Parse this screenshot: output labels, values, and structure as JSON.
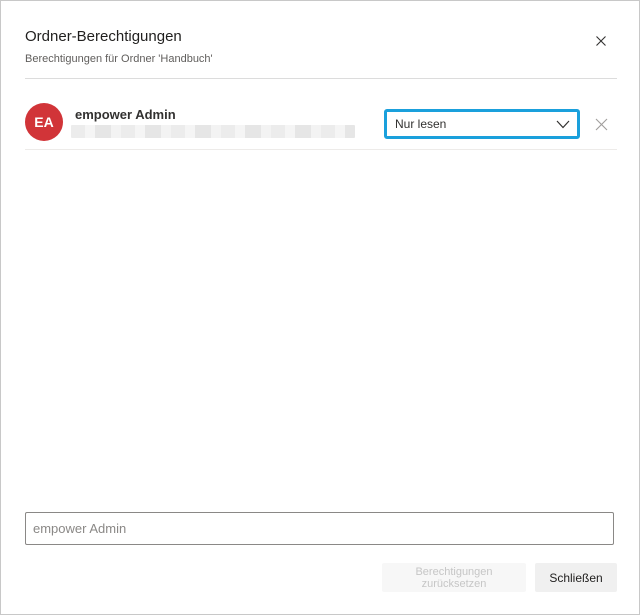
{
  "dialog": {
    "title": "Ordner-Berechtigungen",
    "subtitle": "Berechtigungen für Ordner 'Handbuch'",
    "close_icon": "close-icon"
  },
  "permissions": [
    {
      "initials": "EA",
      "avatar_color": "#d13438",
      "name": "empower Admin",
      "permission": "Nur lesen",
      "remove_icon": "close-icon"
    }
  ],
  "search": {
    "placeholder": "empower Admin",
    "value": ""
  },
  "footer": {
    "reset_label": "Berechtigungen zurücksetzen",
    "reset_enabled": false,
    "close_label": "Schließen"
  },
  "colors": {
    "focus_border": "#1aa0dc",
    "avatar": "#d13438"
  }
}
